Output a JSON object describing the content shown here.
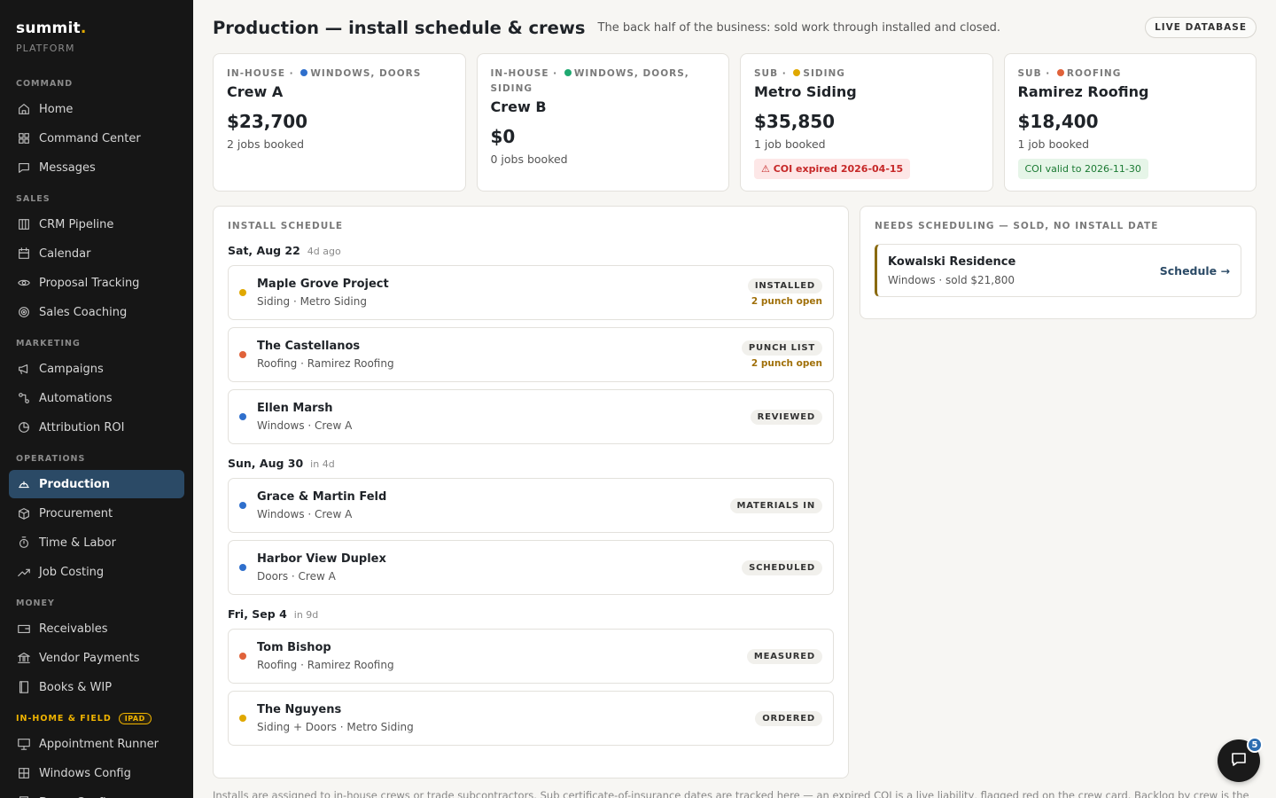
{
  "brand": {
    "name": "summit",
    "dot": ".",
    "subtitle": "PLATFORM"
  },
  "sidebar": {
    "sections": [
      {
        "label": "COMMAND",
        "items": [
          {
            "label": "Home",
            "icon": "home-icon"
          },
          {
            "label": "Command Center",
            "icon": "grid-icon"
          },
          {
            "label": "Messages",
            "icon": "message-icon"
          }
        ]
      },
      {
        "label": "SALES",
        "items": [
          {
            "label": "CRM Pipeline",
            "icon": "columns-icon"
          },
          {
            "label": "Calendar",
            "icon": "calendar-icon"
          },
          {
            "label": "Proposal Tracking",
            "icon": "eye-icon"
          },
          {
            "label": "Sales Coaching",
            "icon": "target-icon"
          }
        ]
      },
      {
        "label": "MARKETING",
        "items": [
          {
            "label": "Campaigns",
            "icon": "megaphone-icon"
          },
          {
            "label": "Automations",
            "icon": "automation-icon"
          },
          {
            "label": "Attribution ROI",
            "icon": "pie-icon"
          }
        ]
      },
      {
        "label": "OPERATIONS",
        "items": [
          {
            "label": "Production",
            "icon": "hardhat-icon",
            "active": true
          },
          {
            "label": "Procurement",
            "icon": "box-icon"
          },
          {
            "label": "Time & Labor",
            "icon": "stopwatch-icon"
          },
          {
            "label": "Job Costing",
            "icon": "trend-icon"
          }
        ]
      },
      {
        "label": "MONEY",
        "items": [
          {
            "label": "Receivables",
            "icon": "wallet-icon"
          },
          {
            "label": "Vendor Payments",
            "icon": "bank-icon"
          },
          {
            "label": "Books & WIP",
            "icon": "book-icon"
          }
        ]
      },
      {
        "label": "IN-HOME & FIELD",
        "badge": "IPAD",
        "accent": true,
        "items": [
          {
            "label": "Appointment Runner",
            "icon": "presentation-icon"
          },
          {
            "label": "Windows Config",
            "icon": "window-icon"
          },
          {
            "label": "Doors Config",
            "icon": "door-icon"
          }
        ]
      }
    ]
  },
  "header": {
    "title": "Production — install schedule & crews",
    "subtitle": "The back half of the business: sold work through installed and closed.",
    "live_label": "LIVE DATABASE"
  },
  "crews": [
    {
      "type": "IN-HOUSE",
      "trades": "WINDOWS, DOORS",
      "dot_color": "#2f6fcc",
      "name": "Crew A",
      "amount": "$23,700",
      "jobs": "2 jobs booked"
    },
    {
      "type": "IN-HOUSE",
      "trades": "WINDOWS, DOORS, SIDING",
      "dot_color": "#1fa971",
      "name": "Crew B",
      "amount": "$0",
      "jobs": "0 jobs booked"
    },
    {
      "type": "SUB",
      "trades": "SIDING",
      "dot_color": "#e0a800",
      "name": "Metro Siding",
      "amount": "$35,850",
      "jobs": "1 job booked",
      "coi": "⚠ COI expired 2026-04-15",
      "coi_state": "bad"
    },
    {
      "type": "SUB",
      "trades": "ROOFING",
      "dot_color": "#e0623a",
      "name": "Ramirez Roofing",
      "amount": "$18,400",
      "jobs": "1 job booked",
      "coi": "COI valid to 2026-11-30",
      "coi_state": "good"
    }
  ],
  "schedule": {
    "title": "INSTALL SCHEDULE",
    "days": [
      {
        "date": "Sat, Aug 22",
        "relative": "4d ago",
        "jobs": [
          {
            "name": "Maple Grove Project",
            "detail": "Siding · Metro Siding",
            "dot_color": "#e0a800",
            "status": "INSTALLED",
            "punch": "2 punch open"
          },
          {
            "name": "The Castellanos",
            "detail": "Roofing · Ramirez Roofing",
            "dot_color": "#e0623a",
            "status": "PUNCH LIST",
            "punch": "2 punch open"
          },
          {
            "name": "Ellen Marsh",
            "detail": "Windows · Crew A",
            "dot_color": "#2f6fcc",
            "status": "REVIEWED"
          }
        ]
      },
      {
        "date": "Sun, Aug 30",
        "relative": "in 4d",
        "jobs": [
          {
            "name": "Grace & Martin Feld",
            "detail": "Windows · Crew A",
            "dot_color": "#2f6fcc",
            "status": "MATERIALS IN"
          },
          {
            "name": "Harbor View Duplex",
            "detail": "Doors · Crew A",
            "dot_color": "#2f6fcc",
            "status": "SCHEDULED"
          }
        ]
      },
      {
        "date": "Fri, Sep 4",
        "relative": "in 9d",
        "jobs": [
          {
            "name": "Tom Bishop",
            "detail": "Roofing · Ramirez Roofing",
            "dot_color": "#e0623a",
            "status": "MEASURED"
          },
          {
            "name": "The Nguyens",
            "detail": "Siding + Doors · Metro Siding",
            "dot_color": "#e0a800",
            "status": "ORDERED"
          }
        ]
      }
    ]
  },
  "needs": {
    "title": "NEEDS SCHEDULING — SOLD, NO INSTALL DATE",
    "items": [
      {
        "name": "Kowalski Residence",
        "detail": "Windows · sold $21,800",
        "action": "Schedule →"
      }
    ]
  },
  "footer_note": "Installs are assigned to in-house crews or trade subcontractors. Sub certificate-of-insurance dates are tracked here — an expired COI is a live liability, flagged red on the crew card. Backlog by crew is the",
  "chat": {
    "unread": "5"
  }
}
